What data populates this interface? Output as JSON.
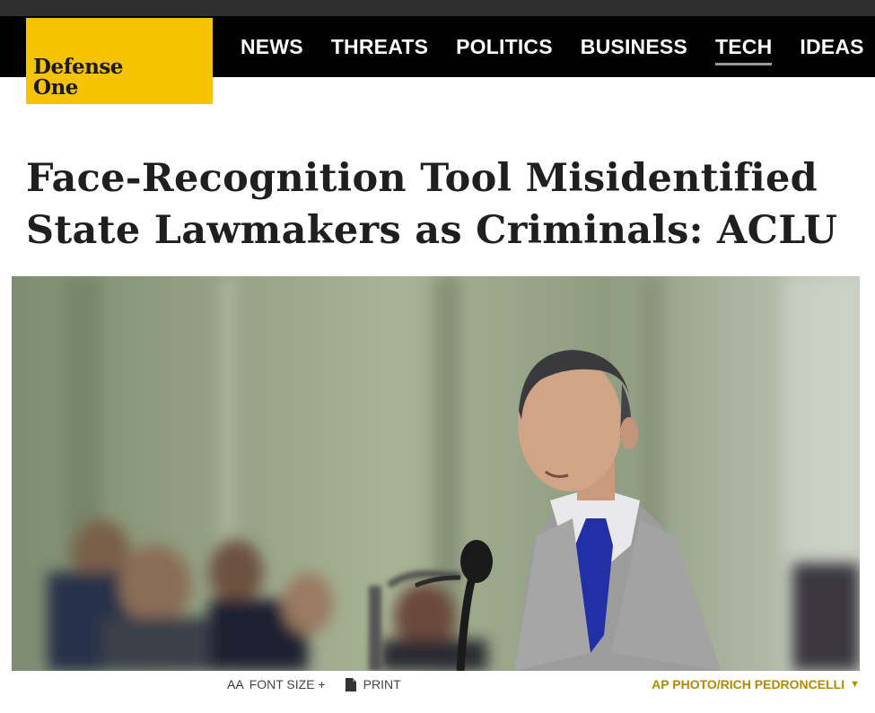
{
  "site": {
    "logo_line1": "Defense",
    "logo_line2": "One"
  },
  "nav": {
    "items": [
      {
        "label": "NEWS"
      },
      {
        "label": "THREATS"
      },
      {
        "label": "POLITICS"
      },
      {
        "label": "BUSINESS"
      },
      {
        "label": "TECH",
        "active": true
      },
      {
        "label": "IDEAS"
      }
    ]
  },
  "article": {
    "headline": "Face-Recognition Tool Misidentified State Lawmakers as Criminals: ACLU"
  },
  "tools": {
    "font_size_glyph": "AA",
    "font_size_label": "FONT SIZE +",
    "print_label": "PRINT"
  },
  "photo": {
    "credit": "AP PHOTO/RICH PEDRONCELLI"
  },
  "colors": {
    "accent": "#f6c300",
    "nav_bg": "#000000",
    "credit": "#b08a00"
  }
}
